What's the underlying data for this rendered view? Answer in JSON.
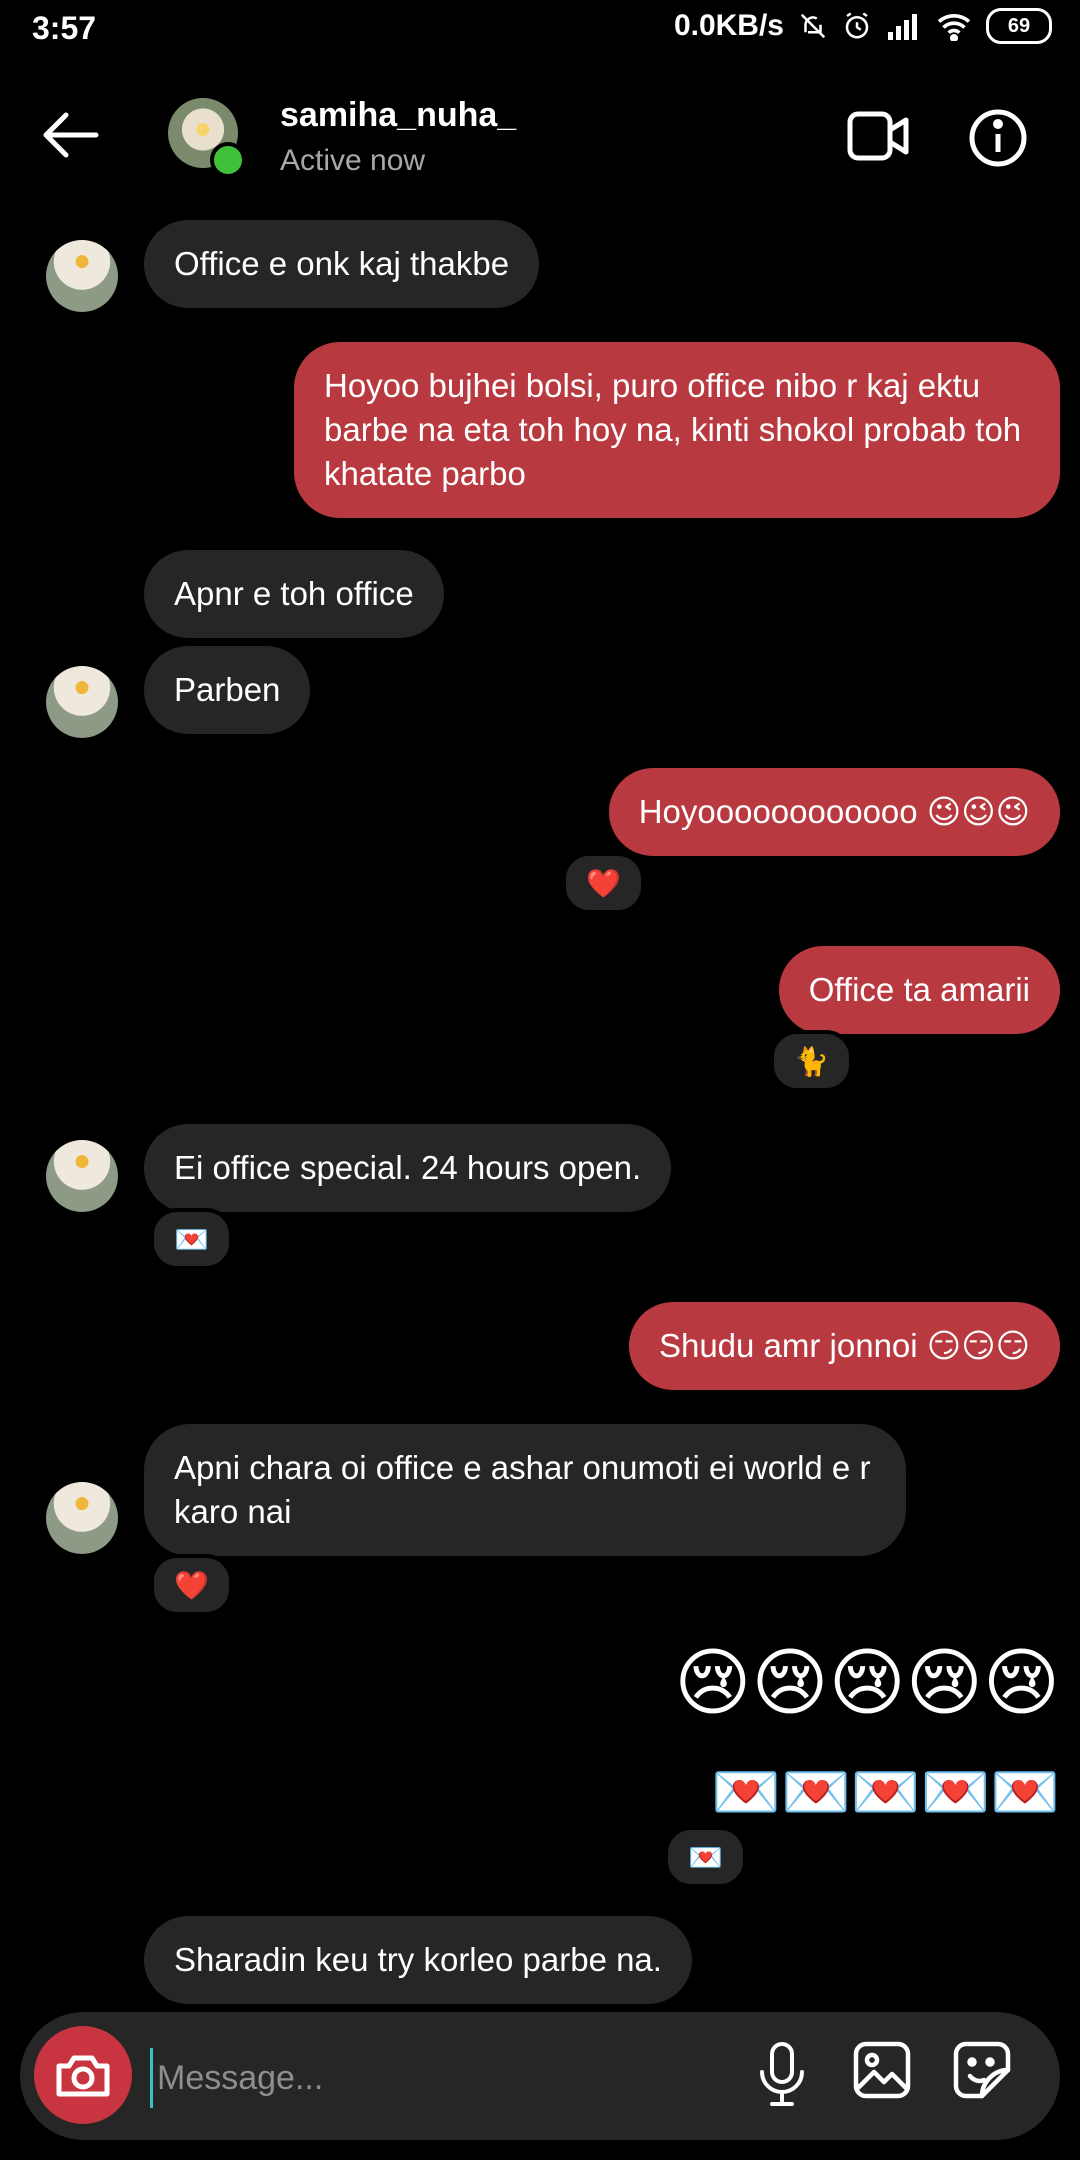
{
  "status": {
    "time": "3:57",
    "net_speed": "0.0KB/s",
    "battery": "69"
  },
  "header": {
    "username": "samiha_nuha_",
    "status": "Active now"
  },
  "messages": [
    {
      "dir": "in",
      "text": "Office e onk kaj thakbe"
    },
    {
      "dir": "out",
      "text": "Hoyoo bujhei bolsi, puro office nibo r kaj ektu barbe na eta toh hoy na, kinti shokol probab toh khatate parbo"
    },
    {
      "dir": "in",
      "text": "Apnr e toh office"
    },
    {
      "dir": "in",
      "text": "Parben"
    },
    {
      "dir": "out",
      "text": "Hoyoooooooooooo 😉😉😉",
      "reaction": "❤️"
    },
    {
      "dir": "out",
      "text": "Office ta amarii",
      "reaction": "🐈"
    },
    {
      "dir": "in",
      "text": "Ei office special. 24 hours open.",
      "reaction": "💌"
    },
    {
      "dir": "out",
      "text": "Shudu amr jonnoi 😏😏😏"
    },
    {
      "dir": "in",
      "text": "Apni chara oi office e ashar onumoti ei world e r karo nai",
      "reaction": "❤️"
    },
    {
      "dir": "out",
      "text": "😢😢😢😢😢"
    },
    {
      "dir": "out",
      "text": "💌💌💌💌💌",
      "reaction": "💌"
    },
    {
      "dir": "in",
      "text": "Sharadin keu try korleo parbe na."
    }
  ],
  "composer": {
    "placeholder": "Message..."
  },
  "colors": {
    "outgoing_bubble": "#b83a40",
    "incoming_bubble": "#262626",
    "online": "#3fc23a",
    "camera_button": "#c8343f"
  }
}
